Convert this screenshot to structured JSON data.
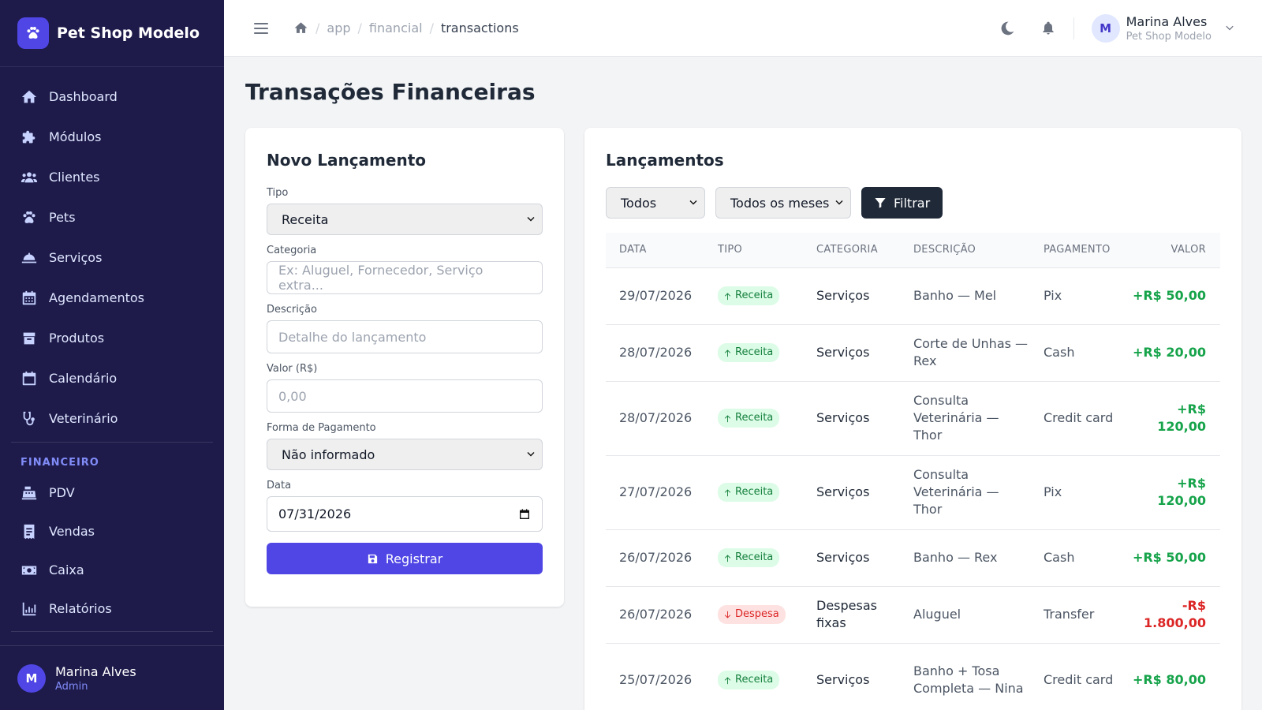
{
  "brand": {
    "name": "Pet Shop Modelo"
  },
  "sidebar": {
    "items": [
      {
        "label": "Dashboard"
      },
      {
        "label": "Módulos"
      },
      {
        "label": "Clientes"
      },
      {
        "label": "Pets"
      },
      {
        "label": "Serviços"
      },
      {
        "label": "Agendamentos"
      },
      {
        "label": "Produtos"
      },
      {
        "label": "Calendário"
      },
      {
        "label": "Veterinário"
      }
    ],
    "section_label": "FINANCEIRO",
    "finance_items": [
      {
        "label": "PDV"
      },
      {
        "label": "Vendas"
      },
      {
        "label": "Caixa"
      },
      {
        "label": "Relatórios"
      }
    ],
    "user": {
      "initial": "M",
      "name": "Marina Alves",
      "role": "Admin"
    }
  },
  "topbar": {
    "breadcrumb": [
      "app",
      "financial",
      "transactions"
    ],
    "user": {
      "initial": "M",
      "name": "Marina Alves",
      "subtitle": "Pet Shop Modelo"
    }
  },
  "page": {
    "title": "Transações Financeiras"
  },
  "form": {
    "title": "Novo Lançamento",
    "tipo_label": "Tipo",
    "tipo_value": "Receita",
    "categoria_label": "Categoria",
    "categoria_placeholder": "Ex: Aluguel, Fornecedor, Serviço extra...",
    "descricao_label": "Descrição",
    "descricao_placeholder": "Detalhe do lançamento",
    "valor_label": "Valor (R$)",
    "valor_placeholder": "0,00",
    "pagamento_label": "Forma de Pagamento",
    "pagamento_value": "Não informado",
    "data_label": "Data",
    "data_value": "07/31/2026",
    "submit_label": "Registrar"
  },
  "list": {
    "title": "Lançamentos",
    "filter_tipo": "Todos",
    "filter_mes": "Todos os meses",
    "filter_button": "Filtrar",
    "columns": [
      "DATA",
      "TIPO",
      "CATEGORIA",
      "DESCRIÇÃO",
      "PAGAMENTO",
      "VALOR"
    ],
    "rows": [
      {
        "data": "29/07/2026",
        "tipo": "Receita",
        "categoria": "Serviços",
        "descricao": "Banho — Mel",
        "pagamento": "Pix",
        "valor": "+R$ 50,00"
      },
      {
        "data": "28/07/2026",
        "tipo": "Receita",
        "categoria": "Serviços",
        "descricao": "Corte de Unhas — Rex",
        "pagamento": "Cash",
        "valor": "+R$ 20,00"
      },
      {
        "data": "28/07/2026",
        "tipo": "Receita",
        "categoria": "Serviços",
        "descricao": "Consulta Veterinária — Thor",
        "pagamento": "Credit card",
        "valor": "+R$ 120,00"
      },
      {
        "data": "27/07/2026",
        "tipo": "Receita",
        "categoria": "Serviços",
        "descricao": "Consulta Veterinária — Thor",
        "pagamento": "Pix",
        "valor": "+R$ 120,00"
      },
      {
        "data": "26/07/2026",
        "tipo": "Receita",
        "categoria": "Serviços",
        "descricao": "Banho — Rex",
        "pagamento": "Cash",
        "valor": "+R$ 50,00"
      },
      {
        "data": "26/07/2026",
        "tipo": "Despesa",
        "categoria": "Despesas fixas",
        "descricao": "Aluguel",
        "pagamento": "Transfer",
        "valor": "-R$ 1.800,00"
      },
      {
        "data": "25/07/2026",
        "tipo": "Receita",
        "categoria": "Serviços",
        "descricao": "Banho + Tosa Completa — Nina",
        "pagamento": "Credit card",
        "valor": "+R$ 80,00"
      }
    ]
  },
  "colors": {
    "sidebar_bg": "#1e1b4b",
    "accent": "#4f46e5",
    "income": "#16a34a",
    "expense": "#dc2626"
  }
}
